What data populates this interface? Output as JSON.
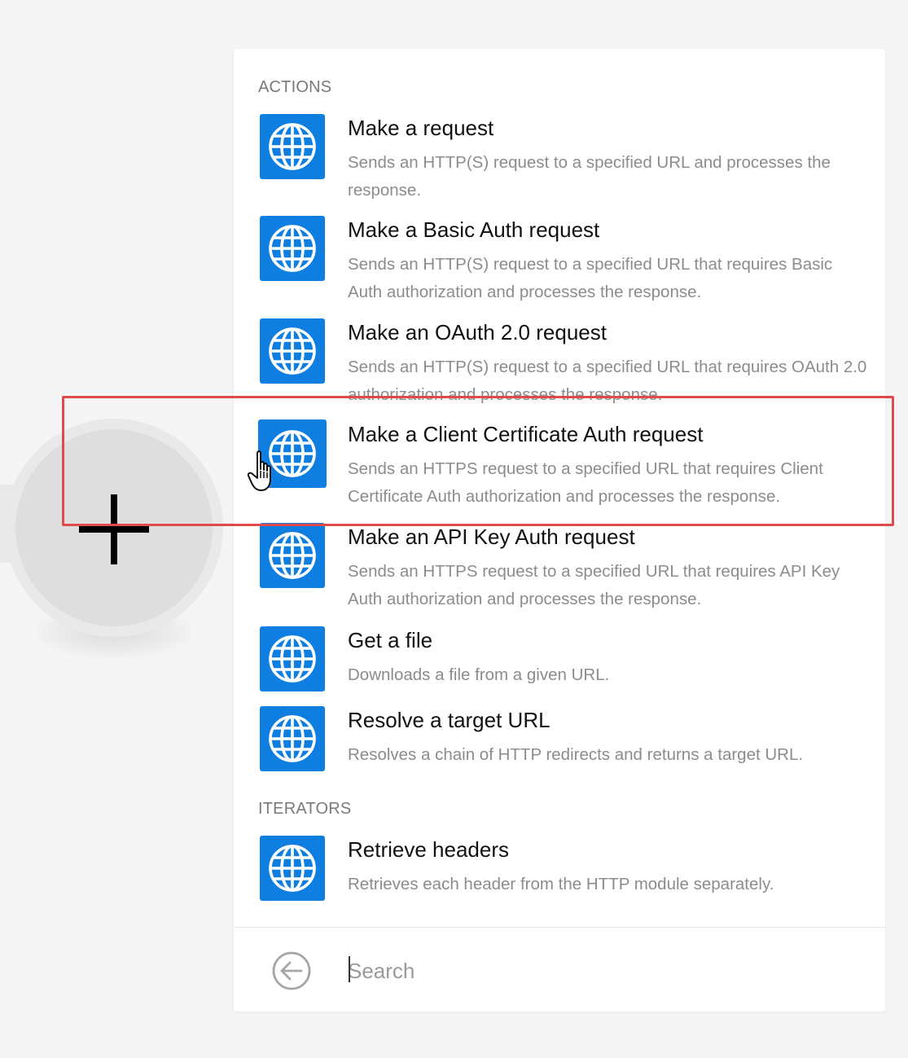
{
  "panel": {
    "sections": [
      {
        "header": "ACTIONS",
        "items": [
          {
            "title": "Make a request",
            "description": "Sends an HTTP(S) request to a specified URL and processes the response."
          },
          {
            "title": "Make a Basic Auth request",
            "description": "Sends an HTTP(S) request to a specified URL that requires Basic Auth authorization and processes the response."
          },
          {
            "title": "Make an OAuth 2.0 request",
            "description": "Sends an HTTP(S) request to a specified URL that requires OAuth 2.0 authorization and processes the response."
          },
          {
            "title": "Make a Client Certificate Auth request",
            "description": "Sends an HTTPS request to a specified URL that requires Client Certificate Auth authorization and processes the response."
          },
          {
            "title": "Make an API Key Auth request",
            "description": "Sends an HTTPS request to a specified URL that requires API Key Auth authorization and processes the response."
          },
          {
            "title": "Get a file",
            "description": "Downloads a file from a given URL."
          },
          {
            "title": "Resolve a target URL",
            "description": "Resolves a chain of HTTP redirects and returns a target URL."
          }
        ]
      },
      {
        "header": "ITERATORS",
        "items": [
          {
            "title": "Retrieve headers",
            "description": "Retrieves each header from the HTTP module separately."
          }
        ]
      }
    ],
    "footer": {
      "search_placeholder": "Search",
      "search_value": ""
    }
  },
  "icons": {
    "module_icon": "globe-icon",
    "back_icon": "arrow-left-circle-icon",
    "add_icon": "plus-icon",
    "cursor_icon": "hand-pointer-icon"
  },
  "colors": {
    "module_icon_bg": "#0e7fe1",
    "highlight": "#e04a4a",
    "canvas_bg": "#f5f5f5",
    "panel_bg": "#ffffff"
  }
}
